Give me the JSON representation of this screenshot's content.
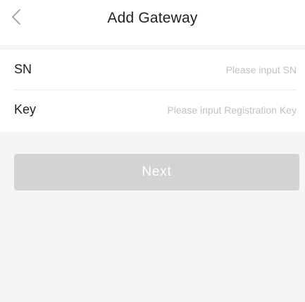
{
  "header": {
    "title": "Add Gateway",
    "back_icon": "chevron-left-icon"
  },
  "form": {
    "sn": {
      "label": "SN",
      "value": "",
      "placeholder": "Please input SN"
    },
    "key": {
      "label": "Key",
      "value": "",
      "placeholder": "Please input Registration Key"
    }
  },
  "actions": {
    "next_label": "Next",
    "next_enabled": false
  },
  "colors": {
    "background": "#f5f5f6",
    "surface": "#ffffff",
    "text": "#222222",
    "placeholder": "#c2c2c2",
    "button_disabled": "#d3d3d4"
  }
}
